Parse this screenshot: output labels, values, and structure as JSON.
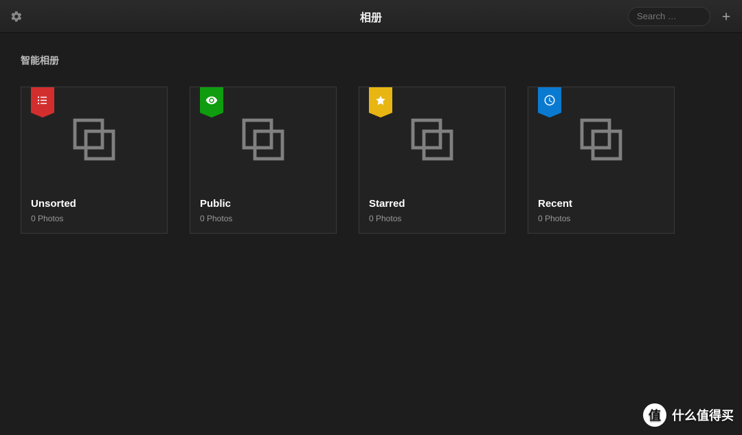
{
  "header": {
    "title": "相册",
    "search_placeholder": "Search …"
  },
  "section": {
    "title": "智能相册"
  },
  "albums": [
    {
      "title": "Unsorted",
      "count": "0 Photos",
      "badge_color": "red",
      "icon": "list-icon"
    },
    {
      "title": "Public",
      "count": "0 Photos",
      "badge_color": "green",
      "icon": "eye-icon"
    },
    {
      "title": "Starred",
      "count": "0 Photos",
      "badge_color": "yellow",
      "icon": "star-icon"
    },
    {
      "title": "Recent",
      "count": "0 Photos",
      "badge_color": "blue",
      "icon": "clock-icon"
    }
  ],
  "watermark": {
    "badge": "值",
    "text": "什么值得买"
  }
}
